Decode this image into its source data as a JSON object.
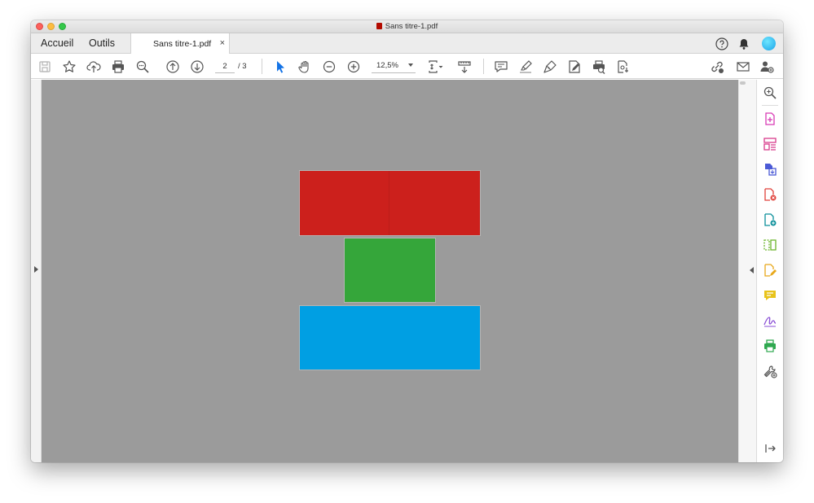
{
  "window": {
    "title": "Sans titre-1.pdf"
  },
  "tabs": {
    "home": "Accueil",
    "tools": "Outils",
    "document": "Sans titre-1.pdf",
    "close_glyph": "×"
  },
  "toolbar": {
    "page_current": "2",
    "page_total": "/ 3",
    "zoom": "12,5%"
  },
  "page_content": {
    "blocks": [
      {
        "name": "red-block",
        "color": "#cc201c"
      },
      {
        "name": "green-block",
        "color": "#35a63a"
      },
      {
        "name": "blue-block",
        "color": "#009fe3"
      }
    ]
  },
  "colors": {
    "viewer_background": "#9b9b9b",
    "select_tool_active": "#1473e6"
  }
}
